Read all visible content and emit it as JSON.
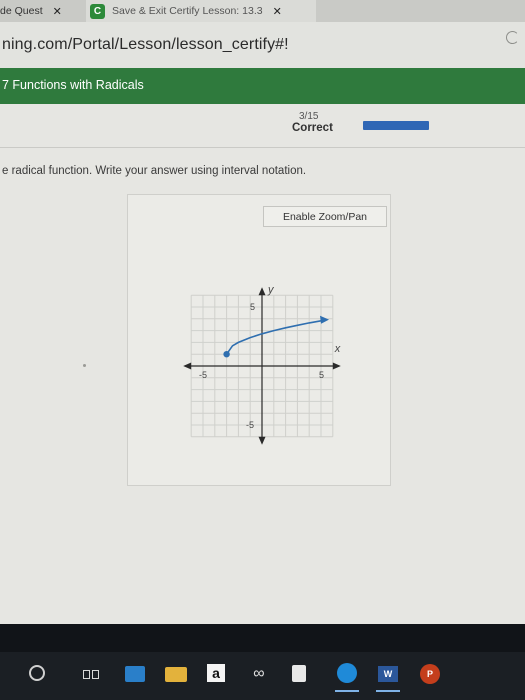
{
  "browser": {
    "tabs": [
      {
        "label": "de Quest",
        "close": "✕"
      },
      {
        "badge": "C",
        "label": "Save & Exit Certify Lesson: 13.3",
        "close": "✕"
      }
    ],
    "url": "ning.com/Portal/Lesson/lesson_certify#!"
  },
  "course": {
    "title": "7 Functions with Radicals"
  },
  "score": {
    "fraction": "3/15",
    "status": "Correct",
    "progress": 0.2
  },
  "question": {
    "prompt": "e radical function. Write your answer using interval notation."
  },
  "graph": {
    "zoom_label": "Enable Zoom/Pan",
    "y_axis_label": "y",
    "x_axis_label": "x",
    "tick_labels": {
      "y_top": "5",
      "x_left": "-5",
      "x_right": "5",
      "y_bottom": "-5"
    },
    "curve_color": "#2f6fb0"
  },
  "chart_data": {
    "type": "line",
    "title": "",
    "xlabel": "x",
    "ylabel": "y",
    "xlim": [
      -6,
      6
    ],
    "ylim": [
      -6,
      6
    ],
    "grid": true,
    "series": [
      {
        "x": [
          -3,
          -2.5,
          -2,
          -1,
          0,
          1,
          2,
          3,
          4,
          5
        ],
        "y": [
          1,
          1.71,
          2,
          2.41,
          2.73,
          3,
          3.24,
          3.45,
          3.65,
          3.83
        ]
      }
    ],
    "endpoint": {
      "x": -3,
      "y": 1,
      "closed": true
    }
  },
  "taskbar": {
    "icons": [
      "search-icon",
      "task-view-icon",
      "store-icon",
      "file-explorer-icon",
      "amazon-icon",
      "infinity-icon",
      "calculator-icon",
      "edge-icon",
      "word-icon",
      "powerpoint-icon"
    ],
    "amazon_glyph": "a",
    "infinity_glyph": "∞",
    "word_glyph": "W",
    "ppt_glyph": "P"
  }
}
